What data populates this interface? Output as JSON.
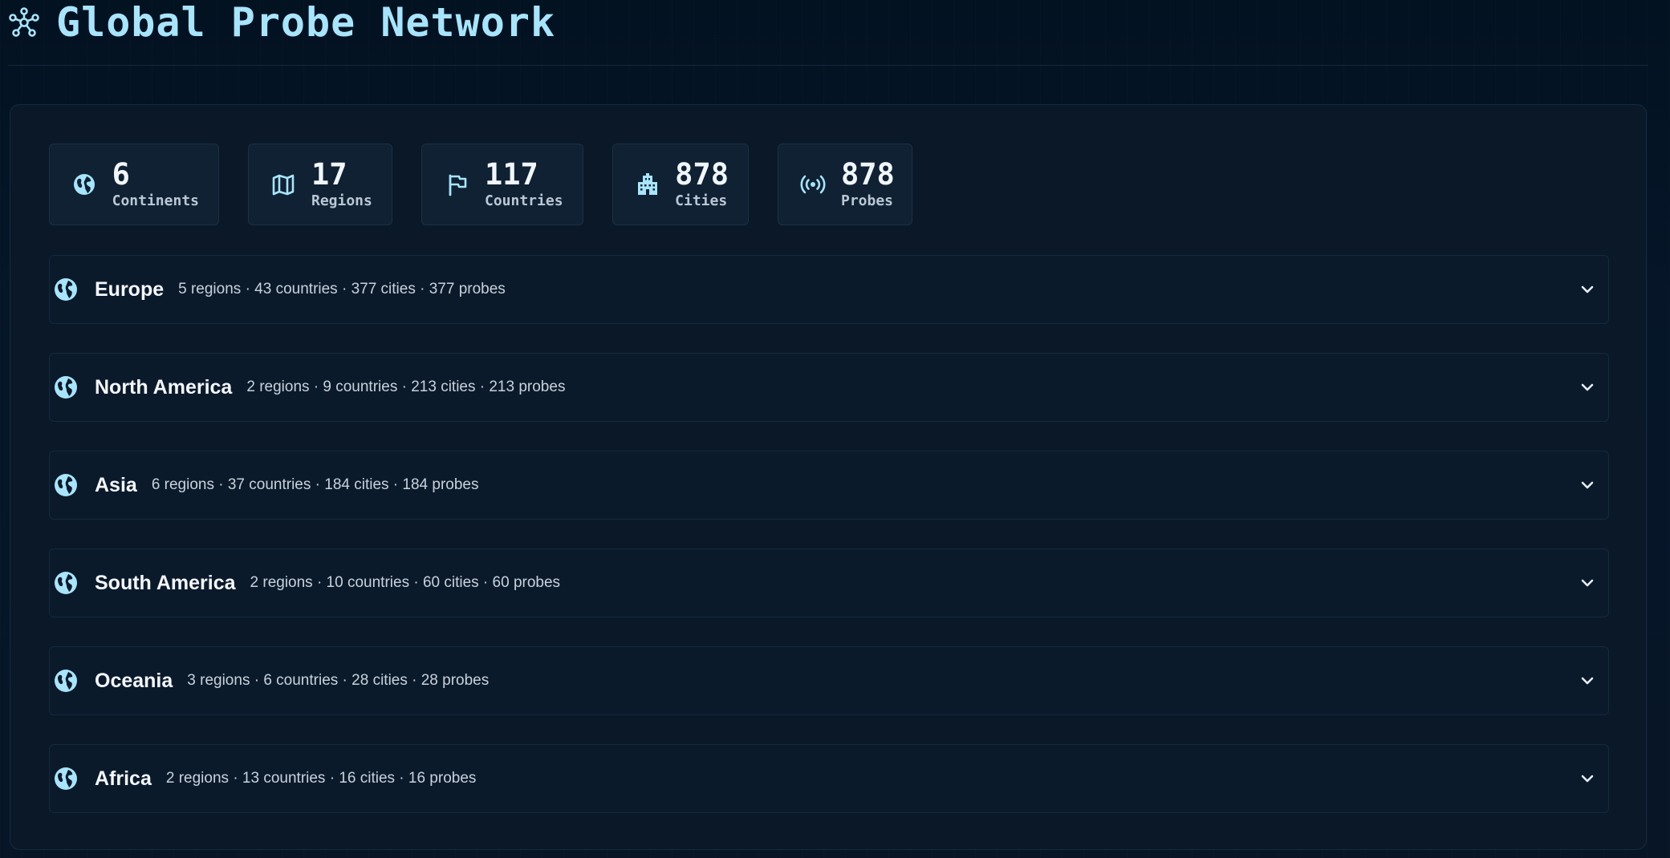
{
  "header": {
    "title": "Global Probe Network",
    "icon": "network-hub-icon"
  },
  "colors": {
    "accent": "#a8e4fb",
    "background": "#04111f",
    "panel": "#0a1828"
  },
  "stats": [
    {
      "value": "6",
      "label": "Continents",
      "icon": "globe-icon"
    },
    {
      "value": "17",
      "label": "Regions",
      "icon": "map-icon"
    },
    {
      "value": "117",
      "label": "Countries",
      "icon": "flag-icon"
    },
    {
      "value": "878",
      "label": "Cities",
      "icon": "building-icon"
    },
    {
      "value": "878",
      "label": "Probes",
      "icon": "broadcast-icon"
    }
  ],
  "continents": [
    {
      "name": "Europe",
      "meta": "5 regions · 43 countries · 377 cities · 377 probes"
    },
    {
      "name": "North America",
      "meta": "2 regions · 9 countries · 213 cities · 213 probes"
    },
    {
      "name": "Asia",
      "meta": "6 regions · 37 countries · 184 cities · 184 probes"
    },
    {
      "name": "South America",
      "meta": "2 regions · 10 countries · 60 cities · 60 probes"
    },
    {
      "name": "Oceania",
      "meta": "3 regions · 6 countries · 28 cities · 28 probes"
    },
    {
      "name": "Africa",
      "meta": "2 regions · 13 countries · 16 cities · 16 probes"
    }
  ]
}
